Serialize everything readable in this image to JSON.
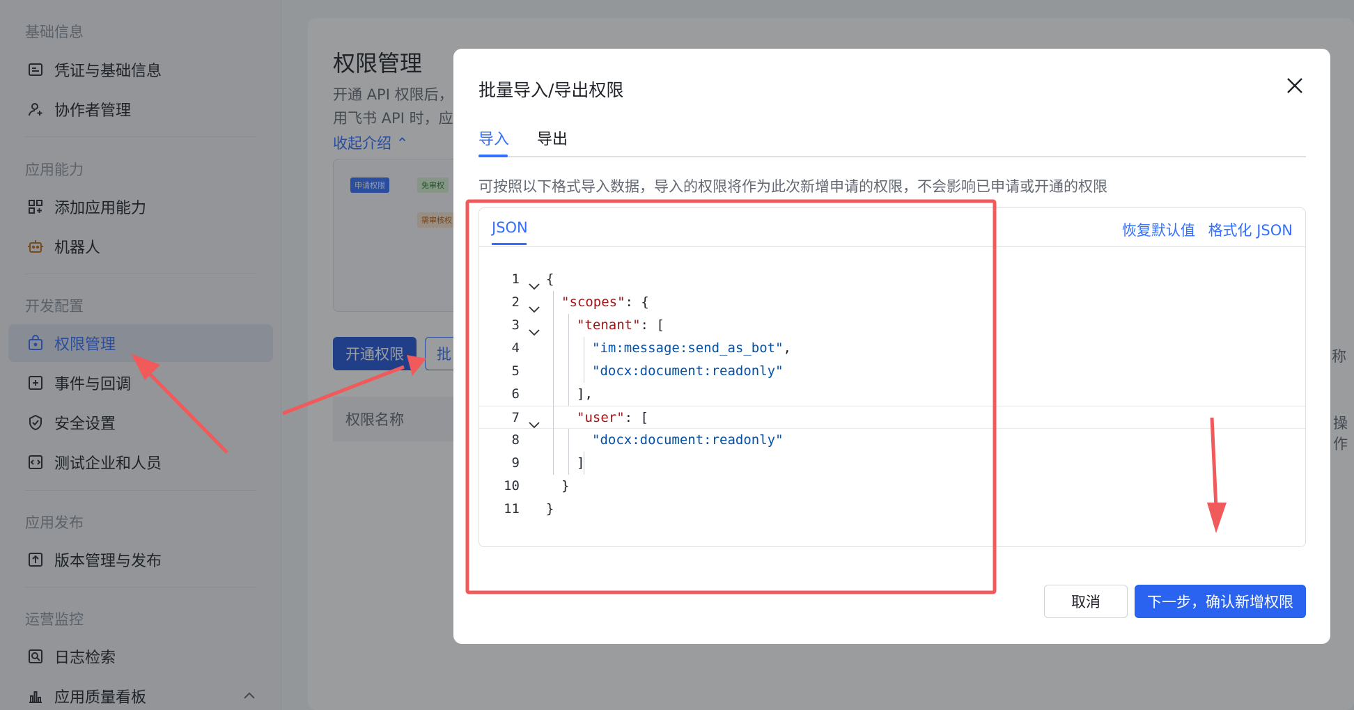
{
  "sidebar": {
    "sections": [
      {
        "title": "基础信息",
        "items": [
          {
            "label": "凭证与基础信息",
            "icon": "credential-icon"
          },
          {
            "label": "协作者管理",
            "icon": "user-add-icon"
          }
        ]
      },
      {
        "title": "应用能力",
        "items": [
          {
            "label": "添加应用能力",
            "icon": "grid-add-icon"
          },
          {
            "label": "机器人",
            "icon": "robot-icon"
          }
        ]
      },
      {
        "title": "开发配置",
        "items": [
          {
            "label": "权限管理",
            "icon": "lock-icon",
            "active": true
          },
          {
            "label": "事件与回调",
            "icon": "event-icon"
          },
          {
            "label": "安全设置",
            "icon": "shield-icon"
          },
          {
            "label": "测试企业和人员",
            "icon": "code-box-icon"
          }
        ]
      },
      {
        "title": "应用发布",
        "items": [
          {
            "label": "版本管理与发布",
            "icon": "upload-box-icon"
          }
        ]
      },
      {
        "title": "运营监控",
        "items": [
          {
            "label": "日志检索",
            "icon": "log-search-icon"
          },
          {
            "label": "应用质量看板",
            "icon": "bar-chart-icon"
          }
        ]
      }
    ]
  },
  "main": {
    "title": "权限管理",
    "desc_line1": "开通 API 权限后，",
    "desc_line2": "用飞书 API 时，应",
    "collapse_label": "收起介绍",
    "diagram": {
      "tag1": "申请权限",
      "tag2": "免审权",
      "tag3": "需审核权"
    },
    "open_button": "开通权限",
    "batch_button": "批",
    "table_header": "权限名称",
    "right_frag_1": "称",
    "right_frag_2": "操作"
  },
  "modal": {
    "title": "批量导入/导出权限",
    "tabs": [
      "导入",
      "导出"
    ],
    "hint": "可按照以下格式导入数据，导入的权限将作为此次新增申请的权限，不会影响已申请或开通的权限",
    "editor": {
      "tab": "JSON",
      "actions": [
        "恢复默认值",
        "格式化 JSON"
      ],
      "lines": [
        {
          "n": "1",
          "fold": true,
          "text": "{"
        },
        {
          "n": "2",
          "fold": true,
          "key": "\"scopes\"",
          "rest": ": {"
        },
        {
          "n": "3",
          "fold": true,
          "key": "\"tenant\"",
          "rest": ": ["
        },
        {
          "n": "4",
          "fold": false,
          "str": "\"im:message:send_as_bot\"",
          "rest": ","
        },
        {
          "n": "5",
          "fold": false,
          "str": "\"docx:document:readonly\"",
          "rest": ""
        },
        {
          "n": "6",
          "fold": false,
          "text": "],"
        },
        {
          "n": "7",
          "fold": true,
          "key": "\"user\"",
          "rest": ": ["
        },
        {
          "n": "8",
          "fold": false,
          "str": "\"docx:document:readonly\"",
          "rest": ""
        },
        {
          "n": "9",
          "fold": false,
          "text": "]"
        },
        {
          "n": "10",
          "fold": false,
          "text": "}"
        },
        {
          "n": "11",
          "fold": false,
          "text": "}"
        }
      ]
    },
    "cancel_button": "取消",
    "confirm_button": "下一步，确认新增权限"
  },
  "colors": {
    "accent": "#3370ff",
    "annotation": "#f05a5a"
  }
}
